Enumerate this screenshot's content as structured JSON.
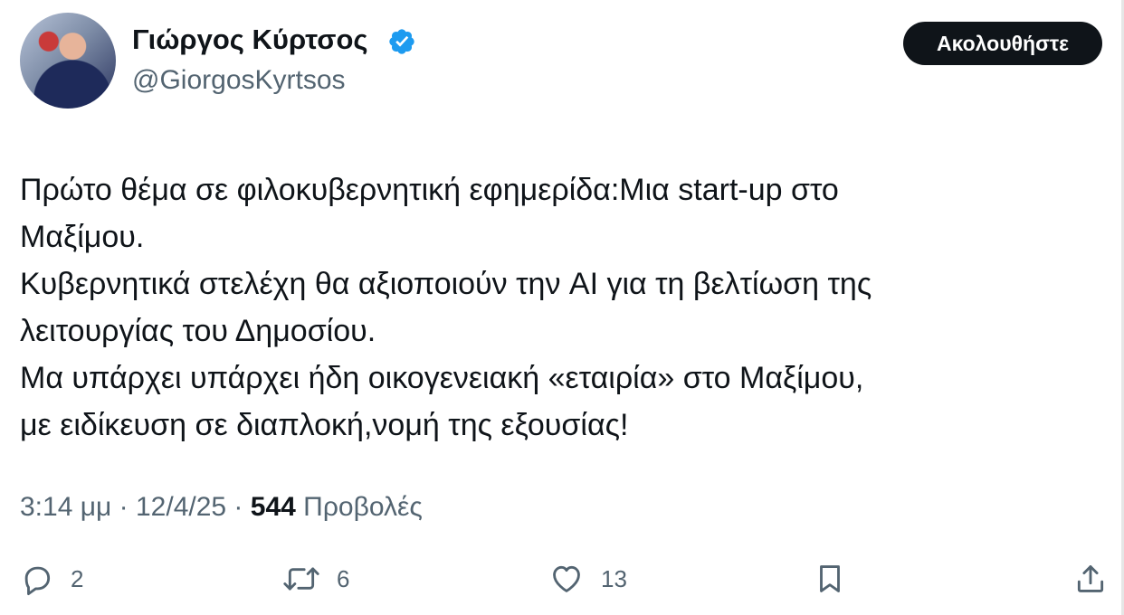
{
  "author": {
    "display_name": "Γιώργος Κύρτσος",
    "handle": "@GiorgosKyrtsos",
    "verified_icon": "verified-badge-icon"
  },
  "follow_button": {
    "label": "Ακολουθήστε"
  },
  "tweet": {
    "lines": [
      "Πρώτο θέμα σε φιλοκυβερνητική εφημερίδα:Μια start-up στο",
      "Μαξίμου.",
      "Κυβερνητικά στελέχη θα αξιοποιούν την AI για τη βελτίωση της",
      "λειτουργίας του Δημοσίου.",
      "Μα υπάρχει υπάρχει ήδη οικογενειακή «εταιρία» στο Μαξίμου,",
      "με ειδίκευση σε διαπλοκή,νομή της εξουσίας!"
    ]
  },
  "meta": {
    "time": "3:14 μμ",
    "separator": "·",
    "date": "12/4/25",
    "views_count": "544",
    "views_label": "Προβολές"
  },
  "actions": {
    "reply_count": "2",
    "retweet_count": "6",
    "like_count": "13"
  },
  "colors": {
    "text_primary": "#0f1419",
    "text_secondary": "#536471",
    "verified_blue": "#1d9bf0",
    "button_bg": "#0f1419"
  }
}
